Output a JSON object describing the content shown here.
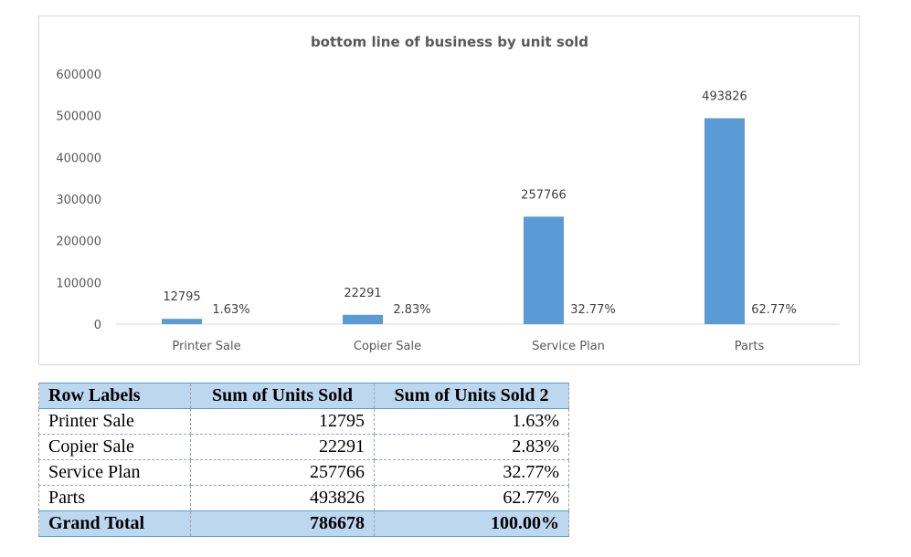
{
  "chart_data": {
    "type": "bar",
    "title": "bottom line of business by unit sold",
    "categories": [
      "Printer Sale",
      "Copier Sale",
      "Service Plan",
      "Parts"
    ],
    "series": [
      {
        "values": [
          12795,
          22291,
          257766,
          493826
        ],
        "data_labels": [
          "12795",
          "22291",
          "257766",
          "493826"
        ]
      },
      {
        "values": [
          0.0163,
          0.0283,
          0.3277,
          0.6277
        ],
        "data_labels": [
          "1.63%",
          "2.83%",
          "32.77%",
          "62.77%"
        ]
      }
    ],
    "yticks": [
      "0",
      "100000",
      "200000",
      "300000",
      "400000",
      "500000",
      "600000"
    ],
    "ylim": [
      0,
      600000
    ],
    "grid": false,
    "legend": "none",
    "bar_color": "#5b9bd5"
  },
  "table": {
    "headers": [
      "Row Labels",
      "Sum of Units Sold",
      "Sum of Units Sold 2"
    ],
    "rows": [
      [
        "Printer Sale",
        "12795",
        "1.63%"
      ],
      [
        "Copier Sale",
        "22291",
        "2.83%"
      ],
      [
        "Service Plan",
        "257766",
        "32.77%"
      ],
      [
        "Parts",
        "493826",
        "62.77%"
      ]
    ],
    "total": [
      "Grand Total",
      "786678",
      "100.00%"
    ]
  }
}
